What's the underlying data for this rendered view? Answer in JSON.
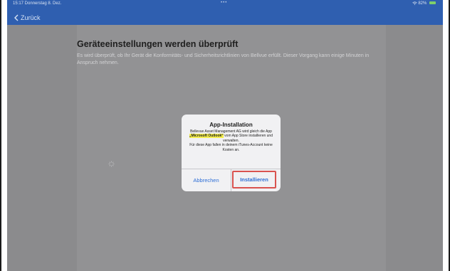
{
  "statusbar": {
    "time_date": "15:17  Donnerstag 8. Dez.",
    "center_dots": "•••",
    "battery": "82%"
  },
  "nav": {
    "back_label": "Zurück"
  },
  "page": {
    "title": "Geräteeinstellungen werden überprüft",
    "description": "Es wird überprüft, ob Ihr Gerät die Konformitäts- und Sicherheitsrichtlinien von Bellvue erfüllt. Dieser Vorgang kann einige Minuten in Anspruch nehmen."
  },
  "dialog": {
    "title": "App-Installation",
    "body_before": "Bellevue Asset Management AG wird gleich die App ",
    "app_name": "„Microsoft Outlook“",
    "body_after": " vom App Store installieren und verwalten.",
    "body_cost": "Für diese App fallen in deinem iTunes-Account keine Kosten an.",
    "cancel_label": "Abbrechen",
    "install_label": "Installieren"
  },
  "colors": {
    "header": "#2f5fb0",
    "overlay": "#8f8f91",
    "accent_link": "#2f6fd6",
    "highlight": "#f4ee4f",
    "annotation_red": "#d9534f"
  },
  "icons": [
    "chevron-left-icon",
    "wifi-icon",
    "battery-icon",
    "spinner-icon"
  ]
}
